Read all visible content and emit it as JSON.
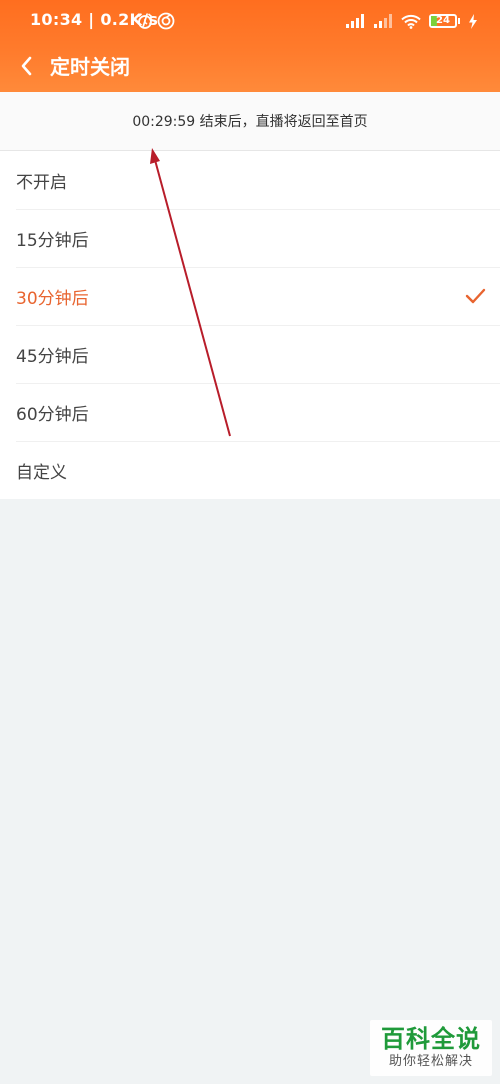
{
  "status_bar": {
    "time": "10:34 | 0.2K/s",
    "battery": "24",
    "battery_level": 0.24,
    "icons": [
      "alarm-icon",
      "app-notification-icon",
      "signal-icon",
      "signal-icon",
      "wifi-icon",
      "battery-icon",
      "charging-icon"
    ]
  },
  "header": {
    "title": "定时关闭",
    "back_icon": "chevron-left-icon",
    "gradient_colors": [
      "#ff6e1f",
      "#ff8a3a"
    ]
  },
  "notice": {
    "text": "00:29:59 结束后，直播将返回至首页"
  },
  "options": [
    {
      "label": "不开启",
      "selected": false
    },
    {
      "label": "15分钟后",
      "selected": false
    },
    {
      "label": "30分钟后",
      "selected": true
    },
    {
      "label": "45分钟后",
      "selected": false
    },
    {
      "label": "60分钟后",
      "selected": false
    },
    {
      "label": "自定义",
      "selected": false
    }
  ],
  "colors": {
    "accent": "#e8642f",
    "background": "#f0f3f4",
    "annotation_arrow": "#b81d2a",
    "watermark_green": "#1f9a3a"
  },
  "watermark": {
    "main": "百科全说",
    "sub": "助你轻松解决"
  }
}
